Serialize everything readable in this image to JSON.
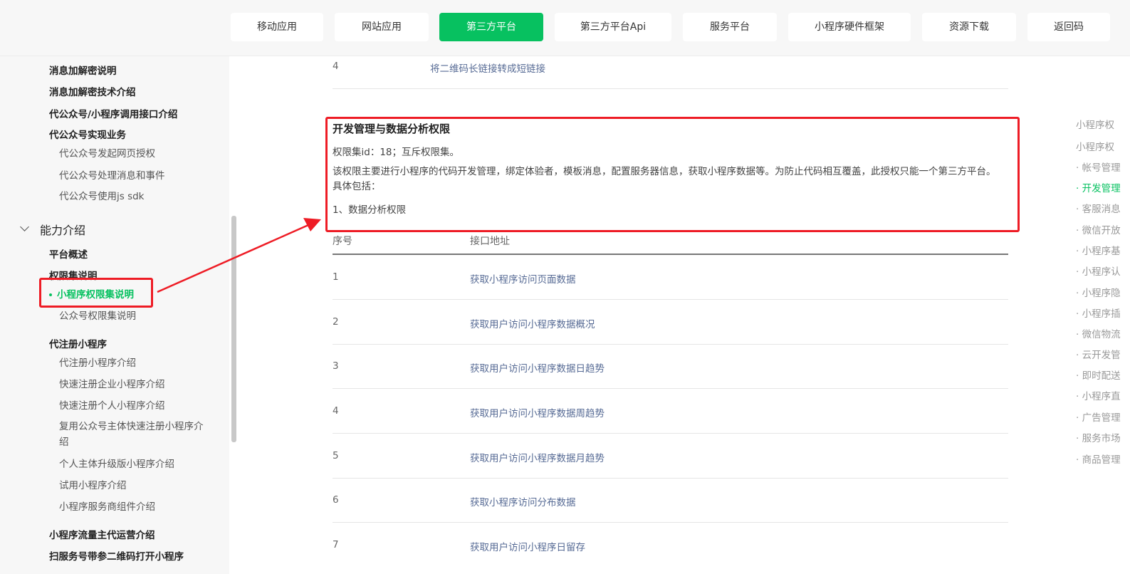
{
  "nav": {
    "items": [
      {
        "label": "移动应用",
        "active": false
      },
      {
        "label": "网站应用",
        "active": false
      },
      {
        "label": "第三方平台",
        "active": true
      },
      {
        "label": "第三方平台Api",
        "active": false
      },
      {
        "label": "服务平台",
        "active": false
      },
      {
        "label": "小程序硬件框架",
        "active": false
      },
      {
        "label": "资源下载",
        "active": false
      },
      {
        "label": "返回码",
        "active": false
      }
    ],
    "accent": "#07c160"
  },
  "sidebar": {
    "items": [
      "消息加解密说明",
      "消息加解密技术介绍",
      "代公众号/小程序调用接口介绍",
      "代公众号实现业务",
      "代公众号发起网页授权",
      "代公众号处理消息和事件",
      "代公众号使用js sdk",
      "能力介绍",
      "平台概述",
      "权限集说明",
      "小程序权限集说明",
      "公众号权限集说明",
      "代注册小程序",
      "代注册小程序介绍",
      "快速注册企业小程序介绍",
      "快速注册个人小程序介绍",
      "复用公众号主体快速注册小程序介绍",
      "个人主体升级版小程序介绍",
      "试用小程序介绍",
      "小程序服务商组件介绍",
      "小程序流量主代运营介绍",
      "扫服务号带参二维码打开小程序"
    ]
  },
  "content": {
    "prev_row": {
      "num": "4",
      "label": "将二维码长链接转成短链接"
    },
    "perm": {
      "title": "开发管理与数据分析权限",
      "id_line": "权限集id：18；互斥权限集。",
      "desc": "该权限主要进行小程序的代码开发管理，绑定体验者，模板消息，配置服务器信息，获取小程序数据等。为防止代码相互覆盖，此授权只能一个第三方平台。具体包括：",
      "sub": "1、数据分析权限"
    },
    "table": {
      "headers": [
        "序号",
        "接口地址"
      ],
      "rows": [
        {
          "num": "1",
          "label": "获取小程序访问页面数据"
        },
        {
          "num": "2",
          "label": "获取用户访问小程序数据概况"
        },
        {
          "num": "3",
          "label": "获取用户访问小程序数据日趋势"
        },
        {
          "num": "4",
          "label": "获取用户访问小程序数据周趋势"
        },
        {
          "num": "5",
          "label": "获取用户访问小程序数据月趋势"
        },
        {
          "num": "6",
          "label": "获取小程序访问分布数据"
        },
        {
          "num": "7",
          "label": "获取用户访问小程序日留存"
        }
      ]
    }
  },
  "toc": {
    "items": [
      "小程序权",
      "小程序权",
      "· 帐号管理",
      "· 开发管理",
      "· 客服消息",
      "· 微信开放",
      "· 小程序基",
      "· 小程序认",
      "· 小程序隐",
      "· 小程序插",
      "· 微信物流",
      "· 云开发管",
      "· 即时配送",
      "· 小程序直",
      "· 广告管理",
      "· 服务市场",
      "· 商品管理"
    ]
  },
  "annotation": {
    "color": "#ee1c25"
  }
}
